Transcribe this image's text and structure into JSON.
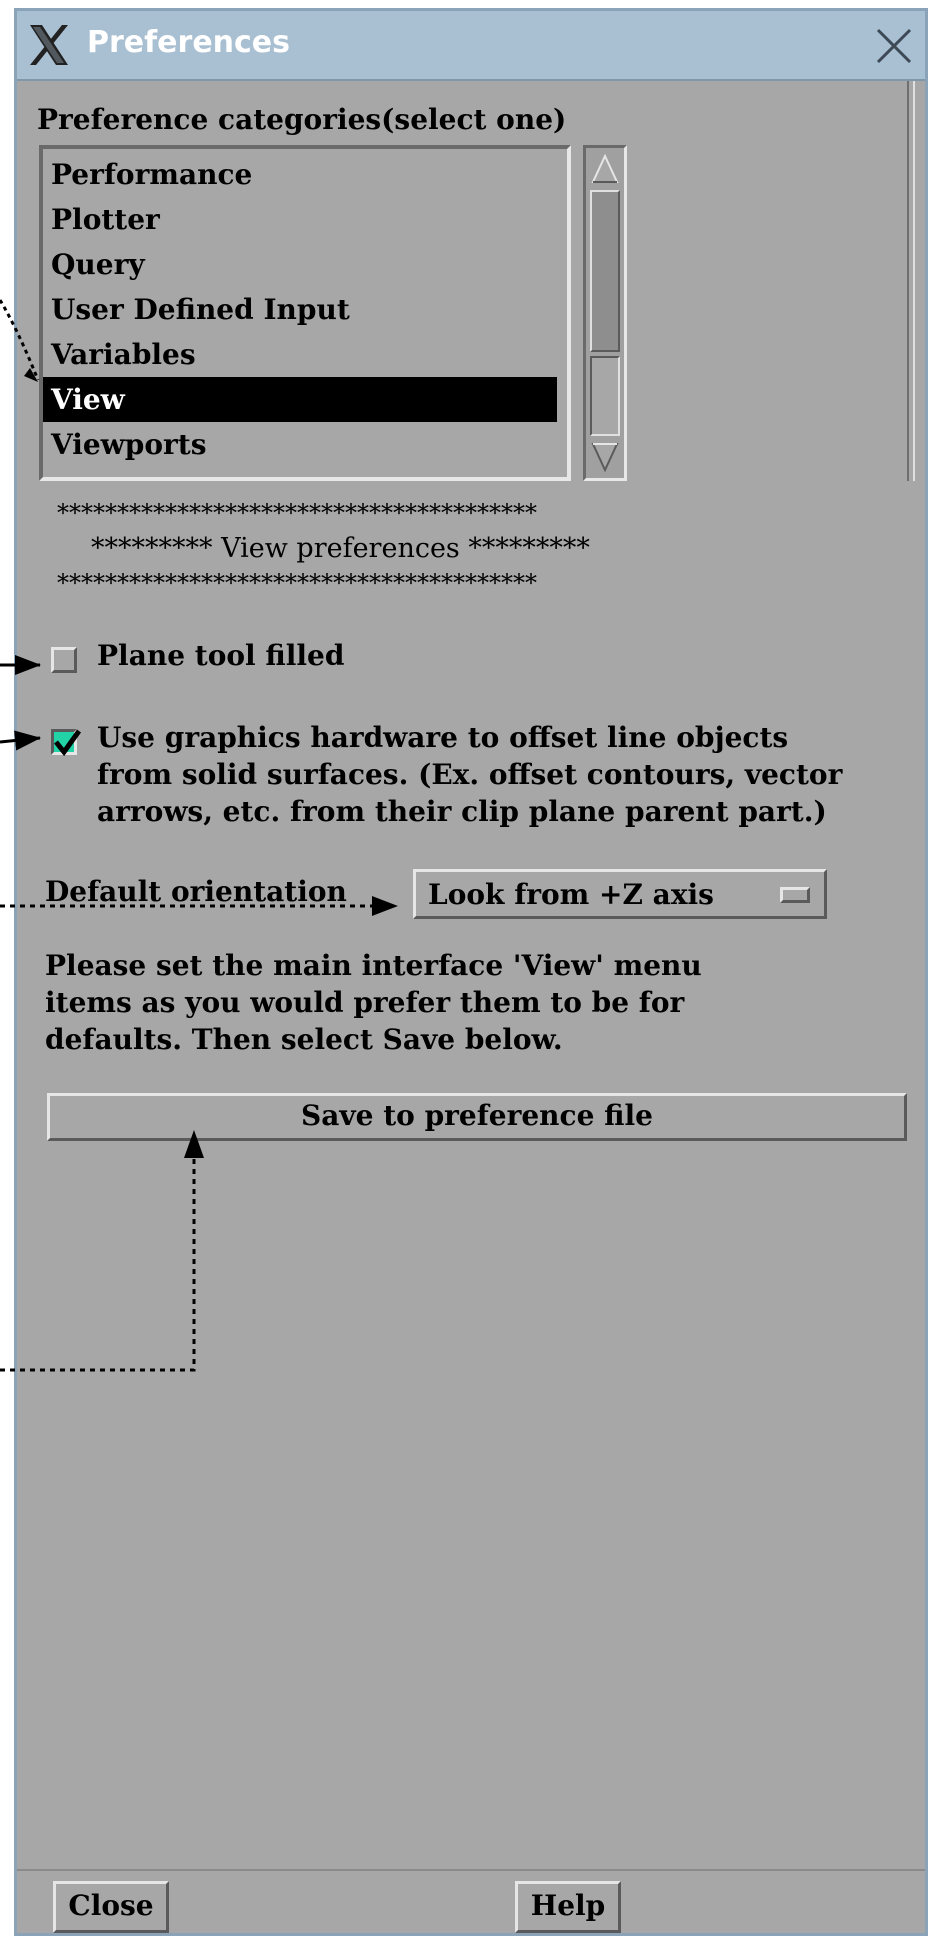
{
  "window": {
    "title": "Preferences",
    "title_bar_color": "#a9bfd2",
    "background_color": "#a7a7a7"
  },
  "categories": {
    "label": "Preference categories(select one)",
    "items": [
      "Performance",
      "Plotter",
      "Query",
      "User Defined Input",
      "Variables",
      "View",
      "Viewports"
    ],
    "selected": "View"
  },
  "section": {
    "stars_line": "****************************************",
    "header": "********* View preferences *********"
  },
  "plane_tool": {
    "label": "Plane tool filled",
    "checked": false
  },
  "graphics_offset": {
    "lines": [
      "Use graphics hardware to offset line objects",
      "from solid surfaces. (Ex. offset contours, vector",
      "arrows, etc. from their clip plane parent part.)"
    ],
    "checked": true,
    "check_color": "#22d3a5"
  },
  "orientation": {
    "label": "Default orientation",
    "value": "Look from +Z axis"
  },
  "instructions": [
    "Please set the main interface 'View' menu",
    "items as you would prefer them to be for",
    "defaults. Then select Save below."
  ],
  "buttons": {
    "save": "Save to preference file",
    "close": "Close",
    "help": "Help"
  },
  "icons": {
    "app_logo": "x-logo-icon",
    "close": "close-icon",
    "scroll_up": "arrow-up-icon",
    "scroll_down": "arrow-down-icon",
    "checkmark": "checkmark-icon",
    "dropdown": "option-menu-indicator-icon"
  }
}
